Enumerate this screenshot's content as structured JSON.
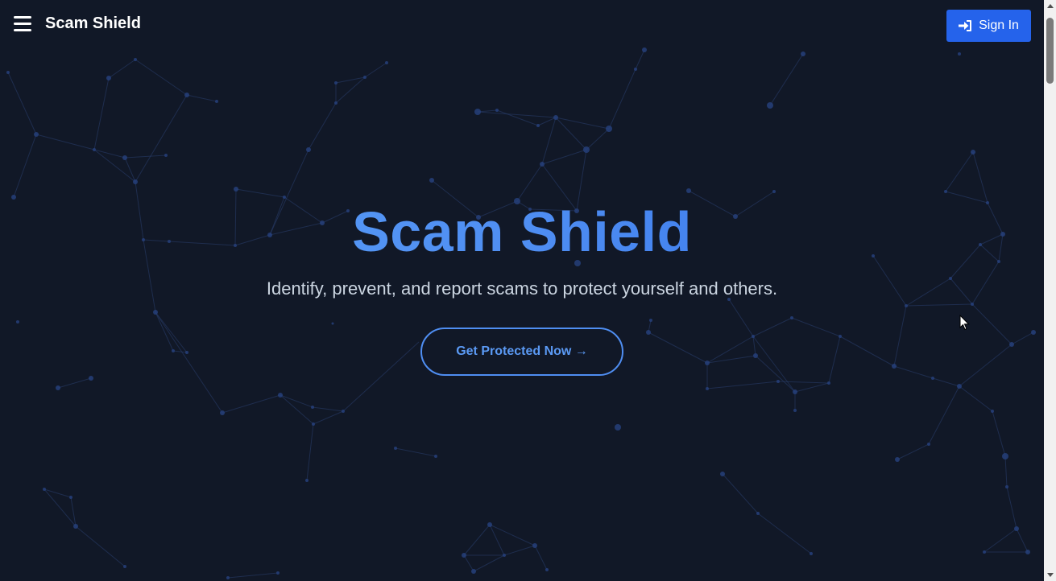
{
  "navbar": {
    "brand": "Scam Shield",
    "menu_icon": "hamburger-menu-icon",
    "signin_label": "Sign In",
    "signin_icon": "sign-in-icon"
  },
  "hero": {
    "title": "Scam Shield",
    "subtitle": "Identify, prevent, and report scams to protect yourself and others.",
    "cta_label": "Get Protected Now →"
  },
  "colors": {
    "background": "#111827",
    "primary": "#2563eb",
    "title_gradient_start": "#5ba1f7",
    "title_gradient_end": "#2f6ee8",
    "cta_border": "#4f8ef2",
    "subtitle": "#cbd5e1",
    "network": "#26407a"
  }
}
